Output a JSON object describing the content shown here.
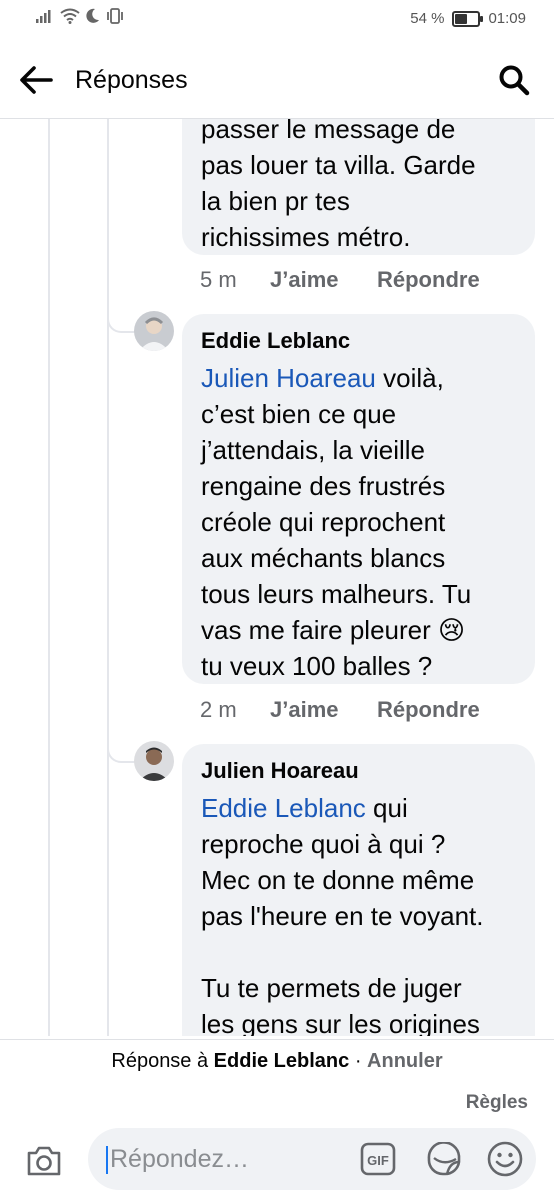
{
  "status_bar": {
    "battery_text": "54 %",
    "battery_level": 0.54,
    "time": "01:09"
  },
  "header": {
    "title": "Réponses"
  },
  "comments": [
    {
      "text": "passer le message de\npas louer ta villa. Garde\nla bien pr tes\nrichissimes métro.",
      "time": "5 m",
      "like_label": "J’aime",
      "reply_label": "Répondre"
    },
    {
      "author": "Eddie Leblanc",
      "mention": "Julien Hoareau",
      "text": " voilà,\nc’est bien ce que\nj’attendais, la vieille\nrengaine des frustrés\ncréole qui reprochent\naux méchants blancs\ntous leurs malheurs. Tu\nvas me faire pleurer 😢\ntu veux 100 balles ?",
      "time": "2 m",
      "like_label": "J’aime",
      "reply_label": "Répondre"
    },
    {
      "author": "Julien Hoareau",
      "mention": "Eddie Leblanc",
      "text": " qui\nreproche quoi à qui ?\nMec on te donne même\npas l'heure en te voyant.\n\nTu te permets de juger\nles gens sur les origines"
    }
  ],
  "reply_banner": {
    "prefix": "Réponse à ",
    "name": "Eddie Leblanc",
    "separator": " · ",
    "cancel": "Annuler"
  },
  "rules_label": "Règles",
  "composer": {
    "placeholder": "Répondez…",
    "gif_label": "GIF"
  },
  "icons": [
    "signal-icon",
    "wifi-icon",
    "moon-icon",
    "vibrate-icon",
    "battery-icon",
    "back-arrow-icon",
    "search-icon",
    "camera-icon",
    "gif-icon",
    "sticker-icon",
    "emoji-icon"
  ],
  "colors": {
    "mention": "#1a58b8",
    "bubble": "#f0f2f5",
    "meta": "#65676b",
    "accent": "#1877f2"
  }
}
